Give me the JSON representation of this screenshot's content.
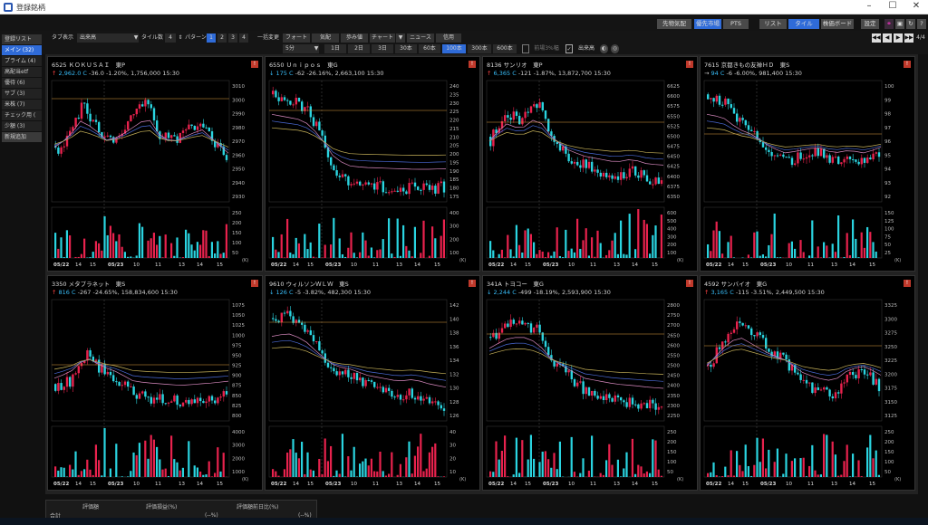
{
  "window": {
    "title": "登録銘柄",
    "page_indicator": "4/4"
  },
  "topbar": {
    "buttons": [
      "先物気配",
      "優先市場",
      "PTS",
      "リスト",
      "タイル",
      "株価ボード",
      "設定"
    ]
  },
  "toolbar": {
    "tab_display_label": "タブ表示",
    "tab_display_value": "出来高",
    "tile_count_label": "タイル数",
    "tile_count_value": "4",
    "pattern_label": "パターン",
    "patterns": [
      "1",
      "2",
      "3",
      "4"
    ],
    "bulk_change_label": "一括変更",
    "row1_buttons": [
      "フォート",
      "気配",
      "歩み値",
      "チャート",
      "▼",
      "ニュース",
      "信用"
    ],
    "interval": "5分",
    "periods": [
      "1日",
      "2日",
      "3日",
      "30本",
      "60本",
      "100本",
      "300本",
      "600本"
    ],
    "checkbox1": "前場3%幅",
    "checkbox2": "出来高"
  },
  "sidebar": {
    "header": "登録リスト",
    "items": [
      "メイン (32)",
      "プライム (4)",
      "高配当etf",
      "優待 (6)",
      "サブ (3)",
      "米株 (7)",
      "チェック用 (",
      "少額 (3)",
      "新規追加"
    ]
  },
  "tiles": [
    {
      "header": "6525 ＫＯＫＵＳＡＩ　東P",
      "arrow": "↑",
      "price": "2,962.0",
      "ccy": "C",
      "change": "-36.0",
      "pct": "-1.20%",
      "volume": "1,756,000",
      "time": "15:30",
      "price_ticks": [
        "3010",
        "3000",
        "2990",
        "2980",
        "2970",
        "2960",
        "2950",
        "2940",
        "2930"
      ],
      "vol_ticks": [
        "250",
        "200",
        "150",
        "100",
        "50"
      ],
      "x_labels": [
        "05/22",
        "14",
        "15",
        "05/23",
        "10",
        "11",
        "13",
        "14",
        "15"
      ]
    },
    {
      "header": "6550 Ｕｎｉｐｏｓ　東G",
      "arrow": "↓",
      "price": "175",
      "ccy": "C",
      "change": "-62",
      "pct": "-26.16%",
      "volume": "2,663,100",
      "time": "15:30",
      "price_ticks": [
        "240",
        "235",
        "230",
        "225",
        "220",
        "215",
        "210",
        "205",
        "200",
        "195",
        "190",
        "185",
        "180",
        "175"
      ],
      "vol_ticks": [
        "400",
        "300",
        "200",
        "100"
      ],
      "x_labels": [
        "05/22",
        "14",
        "15",
        "05/23",
        "10",
        "11",
        "13",
        "14",
        "15"
      ]
    },
    {
      "header": "8136 サンリオ　東P",
      "arrow": "↑",
      "price": "6,365",
      "ccy": "C",
      "change": "-121",
      "pct": "-1.87%",
      "volume": "13,872,700",
      "time": "15:30",
      "price_ticks": [
        "6625",
        "6600",
        "6575",
        "6550",
        "6525",
        "6500",
        "6475",
        "6450",
        "6425",
        "6400",
        "6375",
        "6350"
      ],
      "vol_ticks": [
        "600",
        "500",
        "400",
        "300",
        "200",
        "100"
      ],
      "x_labels": [
        "05/22",
        "14",
        "15",
        "05/23",
        "10",
        "11",
        "13",
        "14",
        "15"
      ]
    },
    {
      "header": "7615 京都きもの友禅ＨＤ　東S",
      "arrow": "→",
      "price": "94",
      "ccy": "C",
      "change": "-6",
      "pct": "-6.00%",
      "volume": "981,400",
      "time": "15:30",
      "price_ticks": [
        "100",
        "99",
        "98",
        "97",
        "96",
        "95",
        "94",
        "93",
        "92"
      ],
      "vol_ticks": [
        "150",
        "125",
        "100",
        "75",
        "50",
        "25"
      ],
      "x_labels": [
        "05/22",
        "14",
        "15",
        "05/23",
        "10",
        "11",
        "13",
        "14",
        "15"
      ]
    },
    {
      "header": "3350 メタプラネット　東S",
      "arrow": "↑",
      "price": "816",
      "ccy": "C",
      "change": "-267",
      "pct": "-24.65%",
      "volume": "158,834,600",
      "time": "15:30",
      "price_ticks": [
        "1075",
        "1050",
        "1025",
        "1000",
        "975",
        "950",
        "925",
        "900",
        "875",
        "850",
        "825",
        "800"
      ],
      "vol_ticks": [
        "4000",
        "3000",
        "2000",
        "1000"
      ],
      "x_labels": [
        "05/22",
        "14",
        "15",
        "05/23",
        "10",
        "11",
        "13",
        "14",
        "15"
      ]
    },
    {
      "header": "9610 ウィルソンＷＬＷ　東S",
      "arrow": "↓",
      "price": "126",
      "ccy": "C",
      "change": "-5",
      "pct": "-3.82%",
      "volume": "482,300",
      "time": "15:30",
      "price_ticks": [
        "142",
        "140",
        "138",
        "136",
        "134",
        "132",
        "130",
        "128",
        "126"
      ],
      "vol_ticks": [
        "40",
        "30",
        "20",
        "10"
      ],
      "x_labels": [
        "05/22",
        "14",
        "15",
        "05/23",
        "10",
        "11",
        "13",
        "14",
        "15"
      ]
    },
    {
      "header": "341A トヨコー　東G",
      "arrow": "↓",
      "price": "2,244",
      "ccy": "C",
      "change": "-499",
      "pct": "-18.19%",
      "volume": "2,593,900",
      "time": "15:30",
      "price_ticks": [
        "2800",
        "2750",
        "2700",
        "2650",
        "2600",
        "2550",
        "2500",
        "2450",
        "2400",
        "2350",
        "2300",
        "2250"
      ],
      "vol_ticks": [
        "250",
        "200",
        "150",
        "100",
        "50"
      ],
      "x_labels": [
        "05/22",
        "14",
        "15",
        "05/23",
        "10",
        "11",
        "13",
        "14",
        "15"
      ]
    },
    {
      "header": "4592 サンバイオ　東G",
      "arrow": "↑",
      "price": "3,165",
      "ccy": "C",
      "change": "-115",
      "pct": "-3.51%",
      "volume": "2,449,500",
      "time": "15:30",
      "price_ticks": [
        "3325",
        "3300",
        "3275",
        "3250",
        "3225",
        "3200",
        "3175",
        "3150",
        "3125"
      ],
      "vol_ticks": [
        "250",
        "200",
        "150",
        "100",
        "50"
      ],
      "x_labels": [
        "05/22",
        "14",
        "15",
        "05/23",
        "10",
        "11",
        "13",
        "14",
        "15"
      ]
    }
  ],
  "vol_unit": "(K)",
  "bottom": {
    "row_label": "合計",
    "col1": "評価額",
    "col2": "評価損益(%)",
    "col3": "評価額前日比(%)",
    "v2": "(--%)",
    "v3": "(--%)"
  },
  "colors": {
    "up": "#e8224d",
    "down": "#2ad4e0",
    "bg": "#000",
    "accent": "#2f6bd8"
  }
}
